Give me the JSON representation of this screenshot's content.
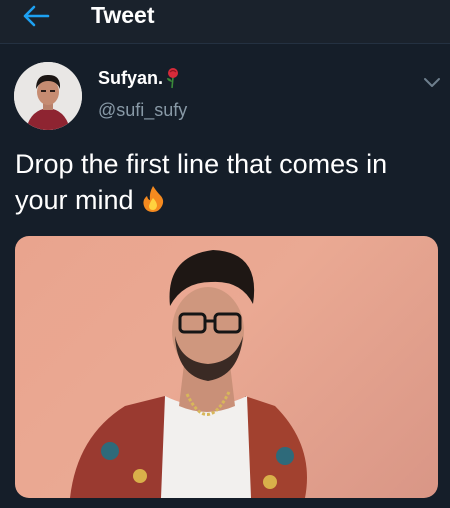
{
  "header": {
    "title": "Tweet",
    "back_icon": "arrow-left-icon"
  },
  "tweet": {
    "display_name": "Sufyan.",
    "name_emoji": "rose-icon",
    "handle": "@sufi_sufy",
    "text": "Drop the first line that comes in your mind",
    "text_emoji": "fire-icon",
    "menu_icon": "chevron-down-icon"
  },
  "colors": {
    "background": "#151e29",
    "accent": "#1da1f2",
    "secondary_text": "#8899a6"
  }
}
